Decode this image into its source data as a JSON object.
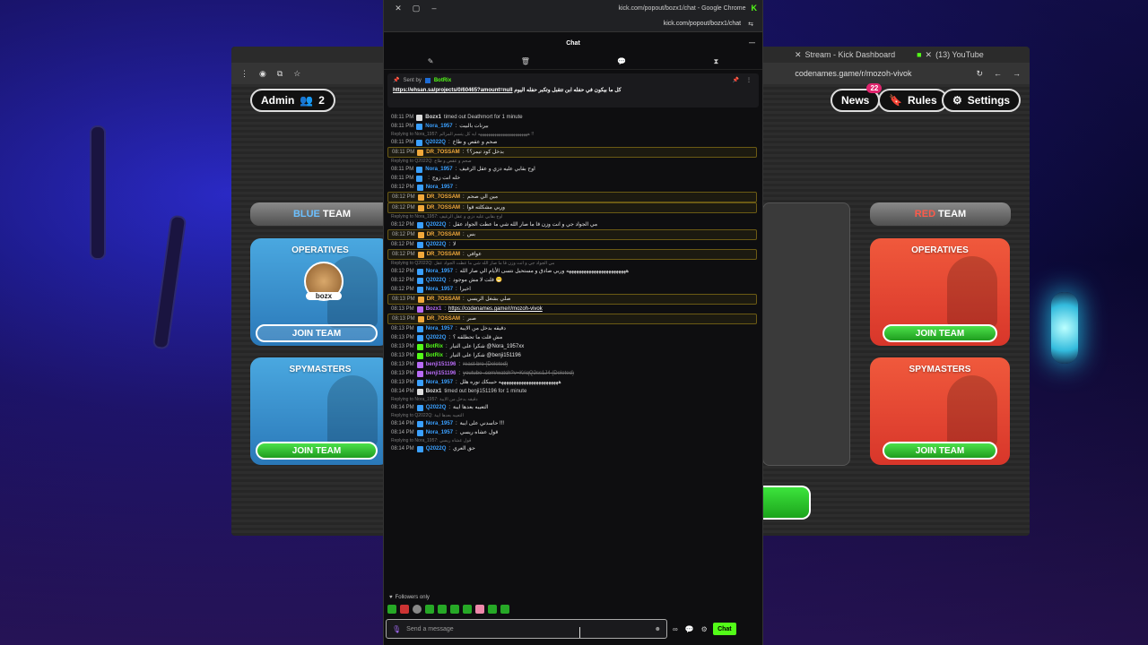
{
  "background_window": {
    "tabs": [
      "Stream - Kick Dashboard",
      "(13) YouTube"
    ],
    "url": "codenames.game/r/mozoh-vivok"
  },
  "game": {
    "admin_label": "Admin",
    "player_count": "2",
    "news_label": "News",
    "news_count": "22",
    "rules_label": "Rules",
    "settings_label": "Settings",
    "blue_team": {
      "prefix": "BLUE",
      "suffix": "TEAM",
      "operatives": "OPERATIVES",
      "spymasters": "SPYMASTERS",
      "player": "bozx",
      "join": "JOIN TEAM"
    },
    "red_team": {
      "prefix": "RED",
      "suffix": "TEAM",
      "operatives": "OPERATIVES",
      "spymasters": "SPYMASTERS",
      "join": "JOIN TEAM"
    },
    "colors": {
      "blue": "#4aa8e0",
      "red": "#f0593c",
      "green": "#2fc22f"
    }
  },
  "chat_window": {
    "title": "kick.com/popout/bozx1/chat - Google Chrome",
    "url": "kick.com/popout/bozx1/chat",
    "header": "Chat",
    "pinned": {
      "sent_by": "Sent by",
      "bot": "BotRix",
      "text": "كل ما بيكون في حفله ابن تتقبل وتكبر حفله اليوم",
      "link": "https://ehsan.sa/projects/0/60465?amount=null"
    },
    "messages": [
      {
        "time": "08:11 PM",
        "user": "Bozx1",
        "text": "timed out Deathmort for 1 minute",
        "color": "#dddddd",
        "system": true
      },
      {
        "time": "08:11 PM",
        "user": "Nora_1957",
        "text": "بيرنات بالبيت",
        "color": "#3aa0ff"
      },
      {
        "reply": "Replying to Nora_1957: ههههههههههههههههههههههههه ايه كل يتسم المزالم !!",
        "time": "08:11 PM",
        "user": "Q2022Q",
        "text": "صحم و عقص و طاخ",
        "color": "#3aa0ff"
      },
      {
        "time": "08:11 PM",
        "user": "DR_7OSSAM",
        "text": "بدخل كود تيمز؟؟",
        "color": "#f2a93b",
        "hl": true
      },
      {
        "reply": "Replying to Q2022Q: صحم و عقص و طاخ",
        "time": "08:11 PM",
        "user": "Nora_1957",
        "text": "اوح بقابي عليه دزي و عقل الرغيف",
        "color": "#3aa0ff"
      },
      {
        "time": "08:11 PM",
        "user": "",
        "text": "خله انت زوج",
        "color": "#3aa0ff"
      },
      {
        "time": "08:12 PM",
        "user": "Nora_1957",
        "text": "",
        "color": "#3aa0ff"
      },
      {
        "time": "08:12 PM",
        "user": "DR_7OSSAM",
        "text": "مين الي صحم",
        "color": "#f2a93b",
        "hl": true
      },
      {
        "time": "08:12 PM",
        "user": "DR_7OSSAM",
        "text": "وربي مشكلته قوا",
        "color": "#f2a93b",
        "hl": true
      },
      {
        "reply": "Replying to Nora_1957: اوح بقابي عليه دزي و عقل الرغيف",
        "time": "08:12 PM",
        "user": "Q2022Q",
        "text": "مي الجواد جي و انت وزن قا ما صار الله شي ما عطت الجواد عقل",
        "color": "#3aa0ff"
      },
      {
        "time": "08:12 PM",
        "user": "DR_7OSSAM",
        "text": "بس",
        "color": "#f2a93b",
        "hl": true
      },
      {
        "time": "08:12 PM",
        "user": "Q2022Q",
        "text": "لا",
        "color": "#3aa0ff"
      },
      {
        "time": "08:12 PM",
        "user": "DR_7OSSAM",
        "text": "عوافي",
        "color": "#f2a93b",
        "hl": true
      },
      {
        "reply": "Replying to Q2022Q: مي الجواد جي و انت وزن قا ما صار الله شي ما عطت الجواد عقل",
        "time": "08:12 PM",
        "user": "Nora_1957",
        "text": "ههههههههههههههههههههههههه وربي صادق و مستحيل نتسى الأيام الي صار الله",
        "color": "#3aa0ff"
      },
      {
        "time": "08:12 PM",
        "user": "Q2022Q",
        "text": "قلت لا مش موجود 😁",
        "color": "#3aa0ff"
      },
      {
        "time": "08:12 PM",
        "user": "Nora_1957",
        "text": "اخيرا",
        "color": "#3aa0ff"
      },
      {
        "time": "08:13 PM",
        "user": "DR_7OSSAM",
        "text": "صلي بشغل الريسي",
        "color": "#f2a93b",
        "hl": true
      },
      {
        "time": "08:13 PM",
        "user": "Bozx1",
        "text": "https://codenames.game/r/mozoh-vivok",
        "color": "#b86bf5",
        "link": true
      },
      {
        "time": "08:13 PM",
        "user": "DR_7OSSAM",
        "text": "صبر",
        "color": "#f2a93b",
        "hl": true
      },
      {
        "time": "08:13 PM",
        "user": "Nora_1957",
        "text": "دقيقه بدخل من الايبة",
        "color": "#3aa0ff"
      },
      {
        "time": "08:13 PM",
        "user": "Q2022Q",
        "text": "مش قلت ما تحطلقه ؟",
        "color": "#3aa0ff"
      },
      {
        "time": "08:13 PM",
        "user": "BotRix",
        "text": "شكرا على التيار @Nora_1957xx",
        "color": "#53fc18"
      },
      {
        "time": "08:13 PM",
        "user": "BotRix",
        "text": "شكرا على التيار @benji151196",
        "color": "#53fc18"
      },
      {
        "time": "08:13 PM",
        "user": "benji151196",
        "text": "react bro (Deleted)",
        "color": "#b86bf5",
        "deleted": true
      },
      {
        "time": "08:13 PM",
        "user": "benji151196",
        "text": "youtube .com/watch?v=KriqQ2ss1J4 (Deleted)",
        "color": "#b86bf5",
        "deleted": true
      },
      {
        "time": "08:13 PM",
        "user": "Nora_1957",
        "text": "ههههههههههههههههههههههههه حبيبكك نوره هلل",
        "color": "#3aa0ff"
      },
      {
        "time": "08:14 PM",
        "user": "Bozx1",
        "text": "timed out benji151196 for 1 minute",
        "color": "#dddddd",
        "system": true
      },
      {
        "reply": "Replying to Nora_1957: دقيقه بدخل من الايبة",
        "time": "08:14 PM",
        "user": "Q2022Q",
        "text": "التعيبه بعدها ايبة",
        "color": "#3aa0ff"
      },
      {
        "reply": "Replying to Q2022Q: التعيبه بعدها ايبة",
        "time": "08:14 PM",
        "user": "Nora_1957",
        "text": "حاسدني على ايبة !!!",
        "color": "#3aa0ff"
      },
      {
        "time": "08:14 PM",
        "user": "Nora_1957",
        "text": "قول عشاه ريسي",
        "color": "#3aa0ff"
      },
      {
        "reply": "Replying to Nora_1957: قول عشاه ريسي",
        "time": "08:14 PM",
        "user": "Q2022Q",
        "text": "حق العري",
        "color": "#3aa0ff"
      }
    ],
    "followers_only": "Followers only",
    "input_placeholder": "Send a message",
    "chat_button": "Chat"
  }
}
